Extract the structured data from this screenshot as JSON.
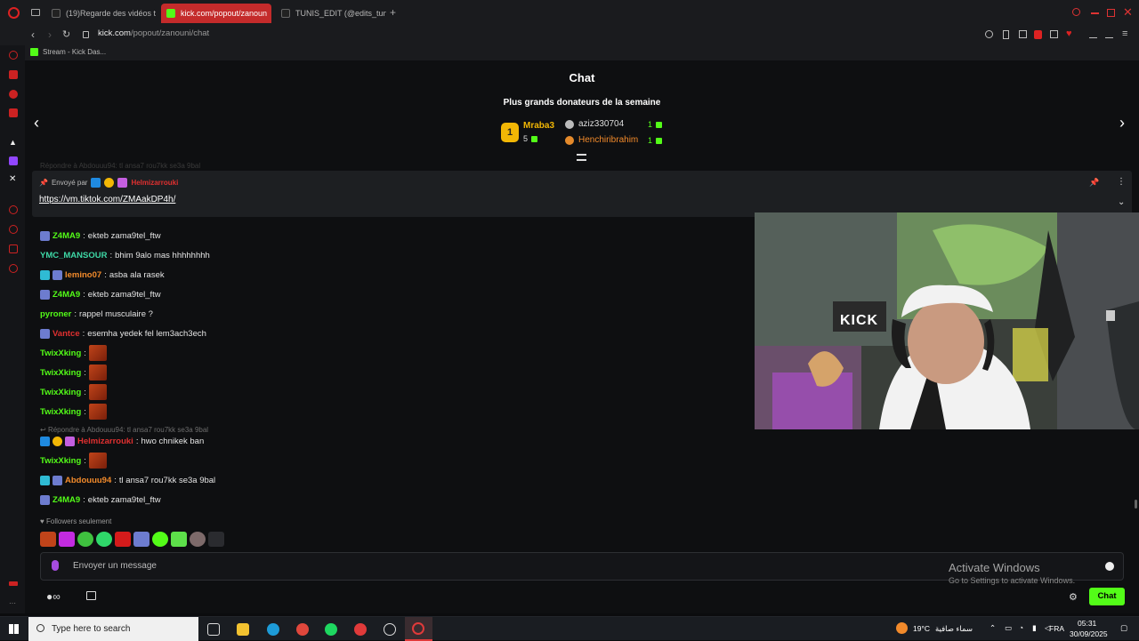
{
  "browser": {
    "tabs": [
      {
        "label": "(19)Regarde des vidéos t"
      },
      {
        "label": "kick.com/popout/zanoun"
      },
      {
        "label": "TUNIS_EDIT (@edits_tunis"
      }
    ],
    "url_domain": "kick.com",
    "url_path": "/popout/zanouni/chat",
    "bookmark": "Stream - Kick Das..."
  },
  "chat": {
    "title": "Chat",
    "donors_title": "Plus grands donateurs de la semaine",
    "donors": [
      {
        "rank": "1",
        "name": "Mraba3",
        "count": "5"
      },
      {
        "name": "aziz330704",
        "count": "1"
      },
      {
        "name": "Henchiribrahim",
        "count": "1"
      }
    ],
    "truncated_reply": "Répondre à Abdouuu94: tl ansa7 rou7kk se3a 9bal",
    "pinned": {
      "label": "Envoyé par",
      "user": "Helmizarrouki",
      "link": "https://vm.tiktok.com/ZMAakDP4h/"
    },
    "messages": [
      {
        "user": "Z4MA9",
        "color": "#53fc18",
        "text": "ekteb zama9tel_ftw"
      },
      {
        "user": "YMC_MANSOUR",
        "color": "#3ed8a6",
        "text": "bhim 9alo mas hhhhhhhh"
      },
      {
        "user": "lemino07",
        "color": "#f38b2b",
        "text": "asba ala rasek"
      },
      {
        "user": "Z4MA9",
        "color": "#53fc18",
        "text": "ekteb zama9tel_ftw"
      },
      {
        "user": "pyroner",
        "color": "#53fc18",
        "text": "rappel musculaire ?"
      },
      {
        "user": "Vantce",
        "color": "#e03030",
        "text": "esemha yedek fel lem3ach3ech"
      },
      {
        "user": "TwixXking",
        "color": "#53fc18",
        "text": ""
      },
      {
        "user": "TwixXking",
        "color": "#53fc18",
        "text": ""
      },
      {
        "user": "TwixXking",
        "color": "#53fc18",
        "text": ""
      },
      {
        "user": "TwixXking",
        "color": "#53fc18",
        "text": ""
      },
      {
        "reply": "Répondre à Abdouuu94: tl ansa7 rou7kk se3a 9bal"
      },
      {
        "user": "Helmizarrouki",
        "color": "#e03030",
        "text": "hwo chnikek ban"
      },
      {
        "user": "TwixXking",
        "color": "#53fc18",
        "text": ""
      },
      {
        "user": "Abdouuu94",
        "color": "#f38b2b",
        "text": "tl ansa7 rou7kk se3a 9bal"
      },
      {
        "user": "Z4MA9",
        "color": "#53fc18",
        "text": "ekteb zama9tel_ftw"
      }
    ],
    "followers_only": "Followers seulement",
    "input_placeholder": "Envoyer un message",
    "chat_button": "Chat"
  },
  "watermark": {
    "title": "Activate Windows",
    "subtitle": "Go to Settings to activate Windows."
  },
  "taskbar": {
    "search_placeholder": "Type here to search",
    "temperature": "19°C",
    "weather": "سماء صافية",
    "lang": "FRA",
    "time": "05:31",
    "date": "30/09/2025"
  },
  "video": {
    "sign": "KICK"
  },
  "colors": {
    "kick_green": "#53fc18",
    "tab_active": "#c42b2b"
  }
}
